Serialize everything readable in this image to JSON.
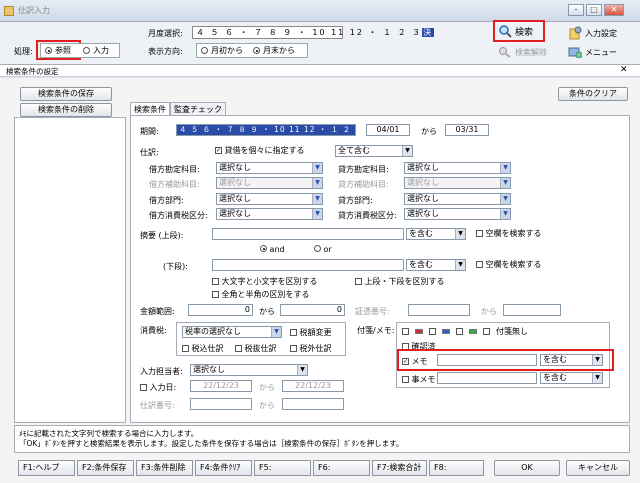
{
  "window": {
    "title": "仕訳入力",
    "controls": [
      "–",
      "□",
      "✕"
    ]
  },
  "toolbar": {
    "month_label": "月度選択:",
    "months": "４ ５ ６ ・ ７ ８ ９ ・ 10 11 12 ・ １ ２ ３",
    "month_final": "決",
    "mode_label": "処理:",
    "mode_ref": "参照",
    "mode_input": "入力",
    "direction_label": "表示方向:",
    "dir_from_month": "月初から",
    "dir_from_end": "月末から",
    "search": "検索",
    "search_clear": "検索解除",
    "input_settings": "入力設定",
    "menu": "メニュー"
  },
  "dialog": {
    "title": "検索条件の設定",
    "close": "✕",
    "save_cond": "検索条件の保存",
    "delete_cond": "検索条件の削除",
    "clear_cond": "条件のクリア",
    "tabs": [
      "検索条件",
      "監査チェック"
    ],
    "period_label": "期間:",
    "period_months": "４ ５ ６ ・ ７ ８ ９ ・ 10 11 12 ・ １ ２ ３ 決",
    "period_from": "04/01",
    "period_to_label": "から",
    "period_to": "03/31",
    "journal_label": "仕訳:",
    "journal_check": "貸借を個々に指定する",
    "journal_include": "全て含む",
    "debit_acct_label": "借方勘定科目:",
    "debit_sub_label": "借方補助科目:",
    "debit_dept_label": "借方部門:",
    "debit_tax_label": "借方消費税区分:",
    "credit_acct_label": "貸方勘定科目:",
    "credit_sub_label": "貸方補助科目:",
    "credit_dept_label": "貸方部門:",
    "credit_tax_label": "貸方消費税区分:",
    "none": "選択なし",
    "desc_upper_label": "摘要 (上段):",
    "desc_lower_label": "(下段):",
    "contains": "を含む",
    "search_blank": "空欄を検索する",
    "and": "and",
    "or": "or",
    "case_check": "大文字と小文字を区別する",
    "updown_check": "上段・下段を区別する",
    "width_check": "全角と半角の区別をする",
    "amount_label": "金額範囲:",
    "amount_from": "0",
    "amount_from_label": "から",
    "amount_to": "0",
    "evidence_label": "証憑番号:",
    "evidence_from_label": "から",
    "tag_label": "付箋/メモ:",
    "tag_none": "付箋無し",
    "tag_approved": "確認済",
    "memo_label": "メモ",
    "memo_contains": "を含む",
    "item_label": "事メモ",
    "item_contains": "を含む",
    "tax_label": "消費税:",
    "tax_none": "税率の選択なし",
    "tax_change": "税額変更",
    "tax_incl": "税込仕訳",
    "tax_excl": "税抜仕訳",
    "tax_out": "税外仕訳",
    "operator_label": "入力担当者:",
    "operator_none": "選択なし",
    "input_date_label": "入力日:",
    "input_date_from": "22/12/23",
    "input_date_mid": "から",
    "input_date_to": "22/12/23",
    "journal_no_label": "仕訳番号:",
    "journal_no_mid": "から",
    "message_line1": "ﾒﾓに記載された文字列で検索する場合に入力します。",
    "message_line2": "「OK」ﾎﾞﾀﾝを押すと検索結果を表示します。設定した条件を保存する場合は［検索条件の保存］ﾎﾞﾀﾝを押します。"
  },
  "fkeys": {
    "f1": "F1:ヘルプ",
    "f2": "F2:条件保存",
    "f3": "F3:条件削除",
    "f4": "F4:条件ｸﾘｱ",
    "f5": "F5:",
    "f6": "F6:",
    "f7": "F7:検索合計",
    "f8": "F8:",
    "ok": "OK",
    "cancel": "キャンセル"
  },
  "colors": {
    "highlight": "#e02020",
    "selection": "#2a4ba8"
  }
}
